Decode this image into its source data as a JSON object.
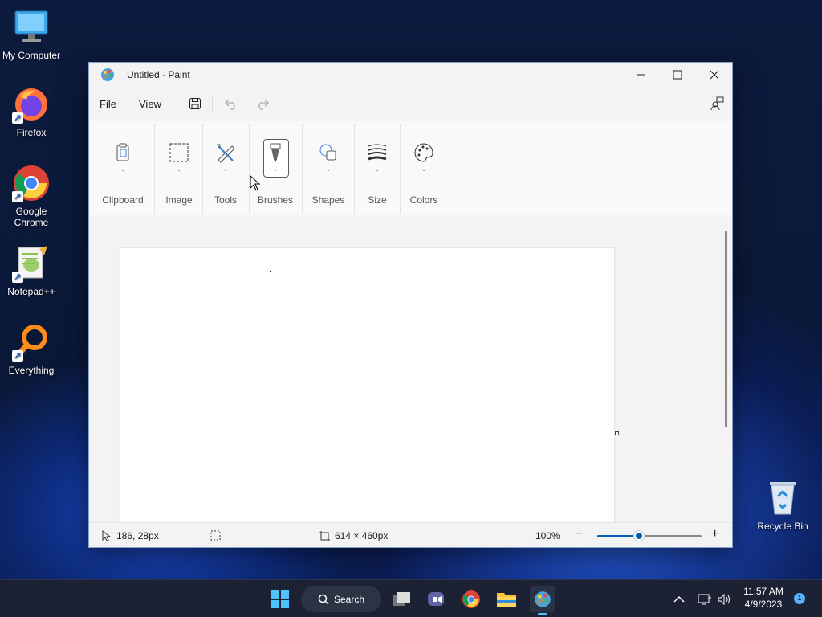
{
  "desktop": {
    "icons": [
      {
        "label": "My Computer",
        "icon": "monitor-icon"
      },
      {
        "label": "Firefox",
        "icon": "firefox-icon"
      },
      {
        "label": "Google Chrome",
        "icon": "chrome-icon"
      },
      {
        "label": "Notepad++",
        "icon": "notepadpp-icon"
      },
      {
        "label": "Everything",
        "icon": "everything-icon"
      },
      {
        "label": "Recycle Bin",
        "icon": "recycle-bin-icon"
      }
    ]
  },
  "window": {
    "title": "Untitled - Paint",
    "menu": {
      "file": "File",
      "view": "View"
    },
    "ribbon": {
      "groups": [
        {
          "label": "Clipboard",
          "icon": "clipboard-icon"
        },
        {
          "label": "Image",
          "icon": "selection-icon"
        },
        {
          "label": "Tools",
          "icon": "tools-icon"
        },
        {
          "label": "Brushes",
          "icon": "brush-icon"
        },
        {
          "label": "Shapes",
          "icon": "shapes-icon"
        },
        {
          "label": "Size",
          "icon": "size-icon"
        },
        {
          "label": "Colors",
          "icon": "palette-icon"
        }
      ]
    },
    "status": {
      "cursor_position": "186, 28px",
      "canvas_size": "614 × 460px",
      "zoom": "100%",
      "zoom_fraction": 0.4
    }
  },
  "taskbar": {
    "search_label": "Search",
    "time": "11:57 AM",
    "date": "4/9/2023",
    "notification_count": "1"
  },
  "colors": {
    "accent": "#005fb8",
    "taskbar": "#1c2233"
  }
}
